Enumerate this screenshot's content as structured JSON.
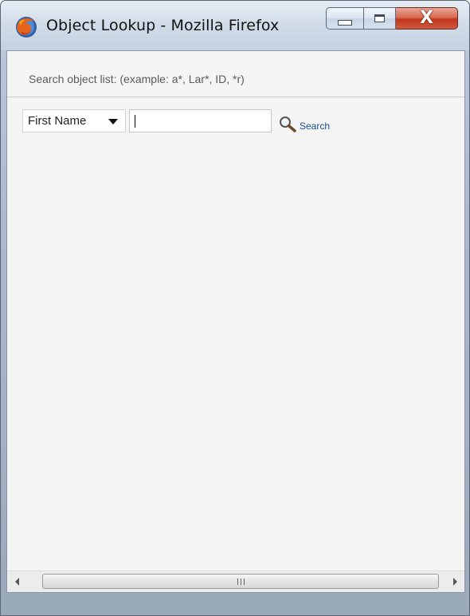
{
  "window": {
    "title": "Object Lookup - Mozilla Firefox",
    "app_icon": "firefox-icon",
    "controls": {
      "minimize_icon": "minimize-icon",
      "maximize_icon": "maximize-icon",
      "close_label": "X"
    }
  },
  "hint": {
    "text": "Search object list: (example: a*, Lar*, ID, *r)"
  },
  "search": {
    "field_selected": "First Name",
    "input_value": "",
    "input_placeholder": "",
    "button_icon": "search-icon",
    "button_label": "Search"
  },
  "colors": {
    "link": "#1a4f96",
    "close_button": "#c2381d",
    "background": "#f5f5f5"
  }
}
